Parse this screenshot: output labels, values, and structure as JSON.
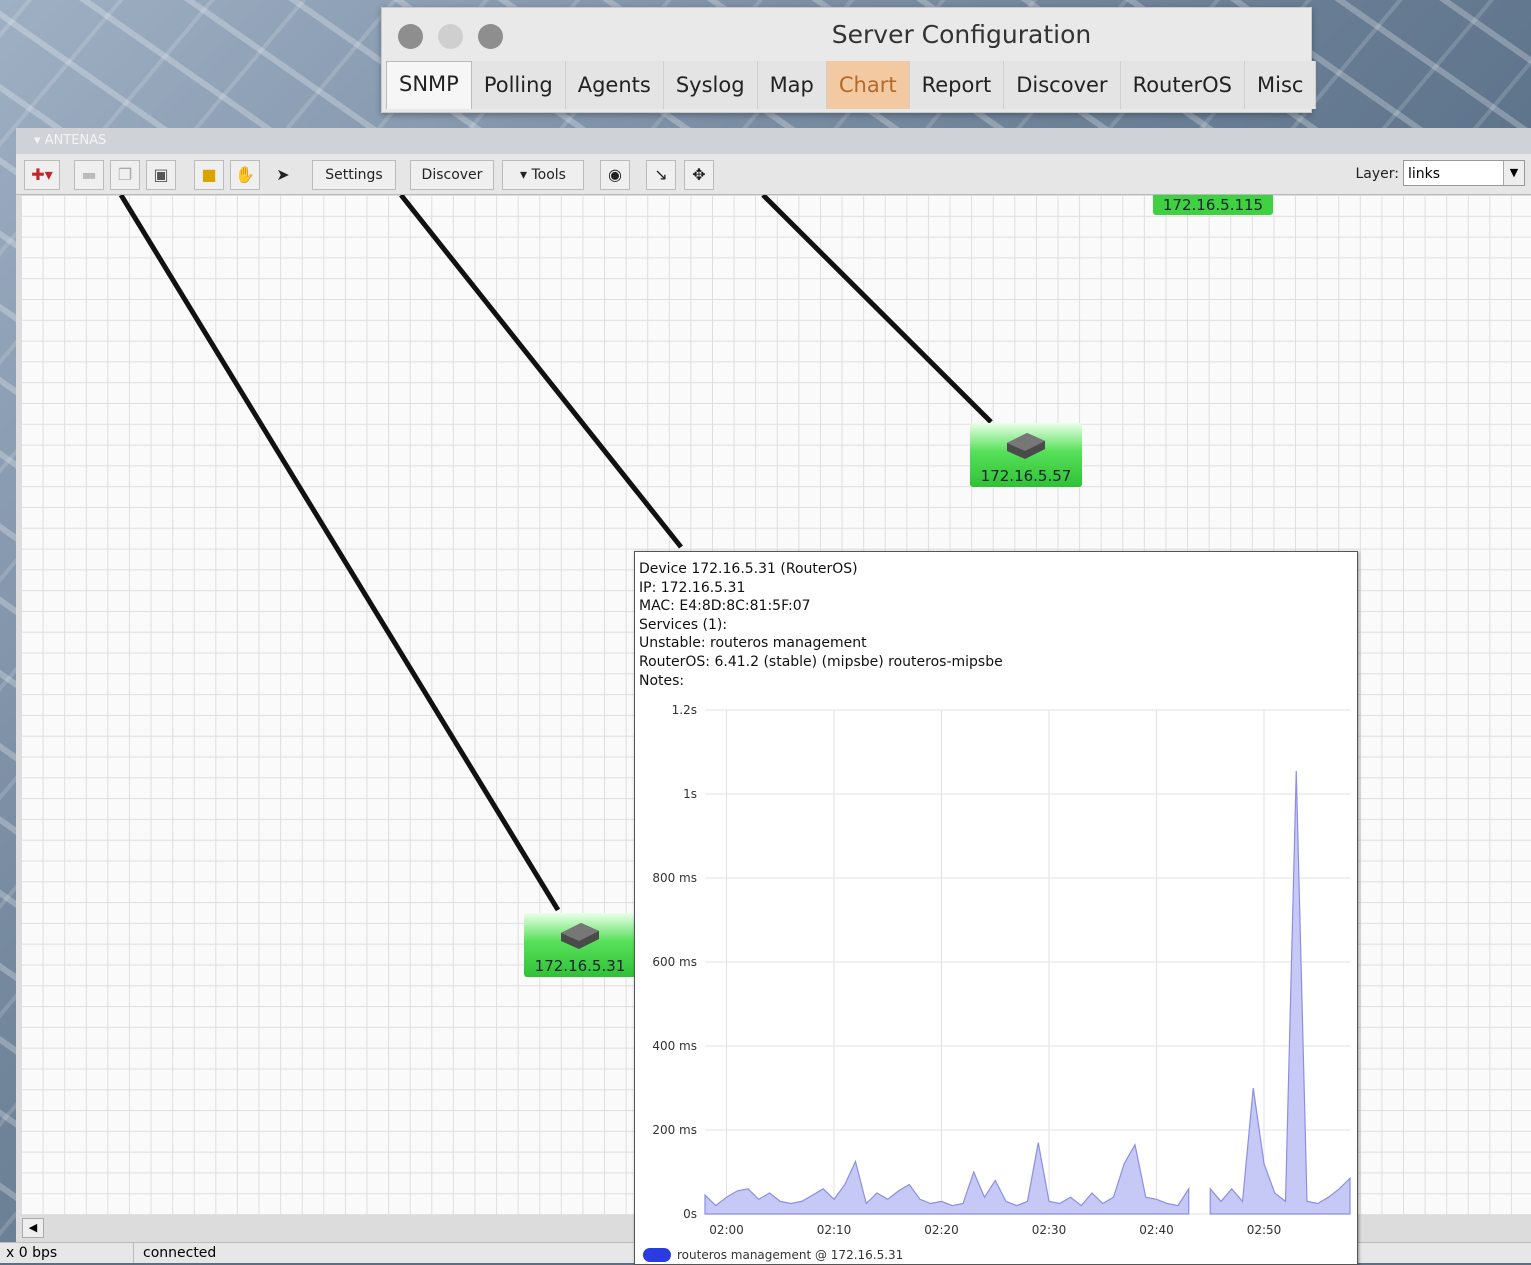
{
  "config_window": {
    "title": "Server Configuration",
    "tabs": [
      "SNMP",
      "Polling",
      "Agents",
      "Syslog",
      "Map",
      "Chart",
      "Report",
      "Discover",
      "RouterOS",
      "Misc"
    ],
    "selected_tab": "SNMP",
    "highlighted_tab": "Chart"
  },
  "map_window": {
    "header_title": "ANTENAS",
    "toolbar": {
      "settings_label": "Settings",
      "discover_label": "Discover",
      "tools_label": "▾ Tools",
      "layer_label": "Layer:",
      "layer_value": "links"
    },
    "nodes": [
      {
        "ip": "172.16.5.115"
      },
      {
        "ip": "172.16.5.57"
      },
      {
        "ip": "172.16.5.31"
      }
    ],
    "status": {
      "traffic": "x 0 bps",
      "connection": "connected"
    }
  },
  "tooltip": {
    "device": "Device 172.16.5.31 (RouterOS)",
    "ip": "IP: 172.16.5.31",
    "mac": "MAC: E4:8D:8C:81:5F:07",
    "services": "Services (1):",
    "unstable": "Unstable: routeros management",
    "routeros": "RouterOS: 6.41.2 (stable) (mipsbe) routeros-mipsbe",
    "notes": "Notes:",
    "legend": "routeros management @ 172.16.5.31"
  },
  "colors": {
    "node_green": "#3fd140",
    "chart_fill": "#c6c8f5",
    "chart_line": "#8b8fe6",
    "legend_swatch": "#2a3be0",
    "highlight_tab": "#f2c9a0"
  },
  "chart_data": {
    "type": "area",
    "title": "",
    "xlabel": "",
    "ylabel": "",
    "y_ticks": [
      "0s",
      "200 ms",
      "400 ms",
      "600 ms",
      "800 ms",
      "1s",
      "1.2s"
    ],
    "x_ticks": [
      "02:00",
      "02:10",
      "02:20",
      "02:30",
      "02:40",
      "02:50"
    ],
    "ylim_ms": [
      0,
      1200
    ],
    "x_range_minutes": [
      118,
      178
    ],
    "series": [
      {
        "name": "routeros management @ 172.16.5.31",
        "points_ms": [
          [
            118,
            45
          ],
          [
            119,
            20
          ],
          [
            120,
            40
          ],
          [
            121,
            55
          ],
          [
            122,
            60
          ],
          [
            123,
            35
          ],
          [
            124,
            50
          ],
          [
            125,
            30
          ],
          [
            126,
            25
          ],
          [
            127,
            30
          ],
          [
            128,
            45
          ],
          [
            129,
            60
          ],
          [
            130,
            35
          ],
          [
            131,
            70
          ],
          [
            132,
            125
          ],
          [
            133,
            25
          ],
          [
            134,
            50
          ],
          [
            135,
            35
          ],
          [
            136,
            55
          ],
          [
            137,
            70
          ],
          [
            138,
            35
          ],
          [
            139,
            25
          ],
          [
            140,
            30
          ],
          [
            141,
            20
          ],
          [
            142,
            25
          ],
          [
            143,
            100
          ],
          [
            144,
            40
          ],
          [
            145,
            80
          ],
          [
            146,
            30
          ],
          [
            147,
            20
          ],
          [
            148,
            30
          ],
          [
            149,
            170
          ],
          [
            150,
            30
          ],
          [
            151,
            25
          ],
          [
            152,
            40
          ],
          [
            153,
            20
          ],
          [
            154,
            50
          ],
          [
            155,
            25
          ],
          [
            156,
            40
          ],
          [
            157,
            120
          ],
          [
            158,
            165
          ],
          [
            159,
            40
          ],
          [
            160,
            35
          ],
          [
            161,
            25
          ],
          [
            162,
            20
          ],
          [
            163,
            60
          ],
          [
            165,
            60
          ],
          [
            166,
            30
          ],
          [
            167,
            60
          ],
          [
            168,
            30
          ],
          [
            169,
            300
          ],
          [
            170,
            120
          ],
          [
            171,
            50
          ],
          [
            172,
            30
          ],
          [
            173,
            1055
          ],
          [
            174,
            30
          ],
          [
            175,
            25
          ],
          [
            176,
            40
          ],
          [
            177,
            60
          ],
          [
            178,
            85
          ]
        ],
        "gap_after_minute": 163
      }
    ]
  }
}
